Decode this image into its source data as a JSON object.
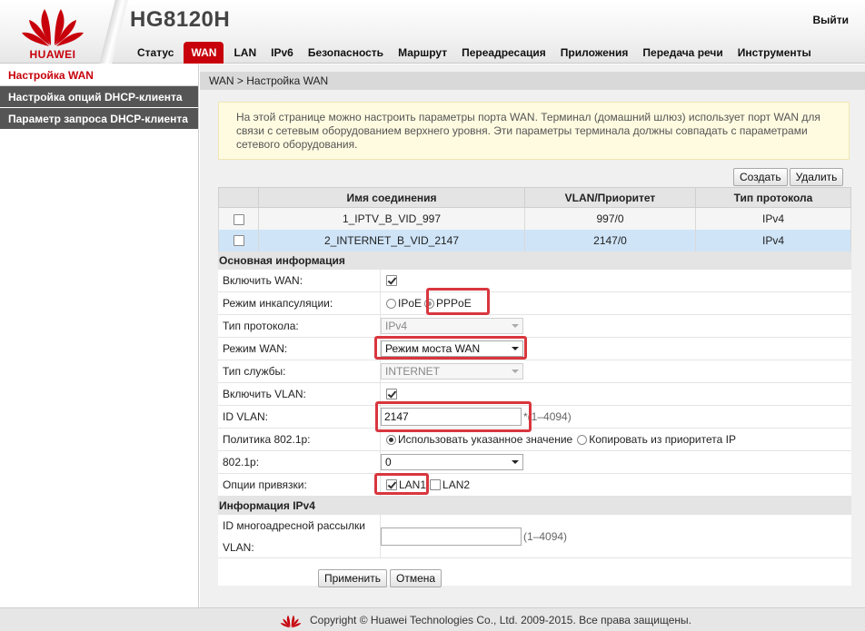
{
  "header": {
    "brand": "HUAWEI",
    "model": "HG8120H",
    "logout": "Выйти"
  },
  "nav": [
    "Статус",
    "WAN",
    "LAN",
    "IPv6",
    "Безопасность",
    "Маршрут",
    "Переадресация",
    "Приложения",
    "Передача речи",
    "Инструменты"
  ],
  "nav_active": "WAN",
  "sidebar": {
    "items": [
      "Настройка WAN",
      "Настройка опций DHCP-клиента",
      "Параметр запроса DHCP-клиента"
    ]
  },
  "breadcrumb": "WAN > Настройка WAN",
  "info_text": "На этой странице можно настроить параметры порта WAN. Терминал (домашний шлюз) использует порт WAN для связи с сетевым оборудованием верхнего уровня. Эти параметры терминала должны совпадать с параметрами сетевого оборудования.",
  "toolbar": {
    "create": "Создать",
    "delete": "Удалить"
  },
  "table": {
    "headers": [
      "Имя соединения",
      "VLAN/Приоритет",
      "Тип протокола"
    ],
    "rows": [
      {
        "name": "1_IPTV_B_VID_997",
        "vlan": "997/0",
        "proto": "IPv4"
      },
      {
        "name": "2_INTERNET_B_VID_2147",
        "vlan": "2147/0",
        "proto": "IPv4"
      }
    ]
  },
  "form": {
    "basic_title": "Основная информация",
    "enable_wan_label": "Включить WAN:",
    "encap_label": "Режим инкапсуляции:",
    "encap_ipoe": "IPoE",
    "encap_pppoe": "PPPoE",
    "proto_label": "Тип протокола:",
    "proto_value": "IPv4",
    "wan_mode_label": "Режим WAN:",
    "wan_mode_value": "Режим моста WAN",
    "service_label": "Тип службы:",
    "service_value": "INTERNET",
    "enable_vlan_label": "Включить VLAN:",
    "vlan_id_label": "ID VLAN:",
    "vlan_id_value": "2147",
    "vlan_id_hint": "*(1–4094)",
    "policy_label": "Политика 802.1p:",
    "policy_opt1": "Использовать указанное значение",
    "policy_opt2": "Копировать из приоритета IP",
    "p8021_label": "802.1p:",
    "p8021_value": "0",
    "binding_label": "Опции привязки:",
    "binding_lan1": "LAN1",
    "binding_lan2": "LAN2",
    "ipv4_title": "Информация IPv4",
    "mcast_label": "ID многоадресной рассылки VLAN:",
    "mcast_value": "",
    "mcast_hint": "(1–4094)"
  },
  "actions": {
    "apply": "Применить",
    "cancel": "Отмена"
  },
  "footer": "Copyright © Huawei Technologies Co., Ltd. 2009-2015. Все права защищены.",
  "colors": {
    "brand_red": "#c7000b",
    "highlight_box": "#d9363e",
    "selected_row": "#cfe4f7"
  }
}
